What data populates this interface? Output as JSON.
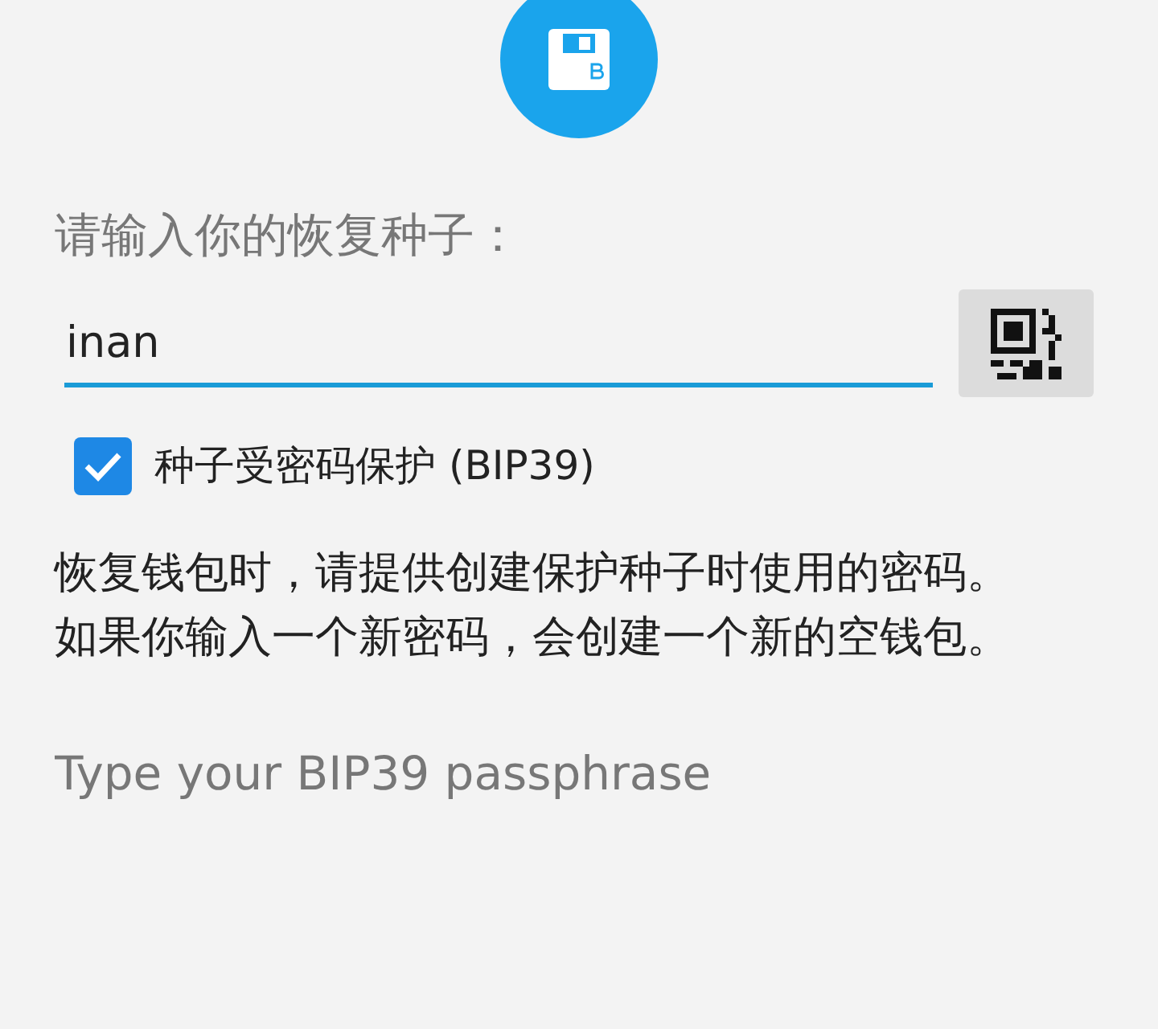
{
  "prompt": "请输入你的恢复种子：",
  "seed_field": {
    "value": "inan"
  },
  "passphrase_option": {
    "label": "种子受密码保护 (BIP39)",
    "checked": true
  },
  "explanation": [
    "恢复钱包时，请提供创建保护种子时使用的密码。",
    "如果你输入一个新密码，会创建一个新的空钱包。"
  ],
  "passphrase_field": {
    "placeholder": "Type your BIP39 passphrase"
  }
}
